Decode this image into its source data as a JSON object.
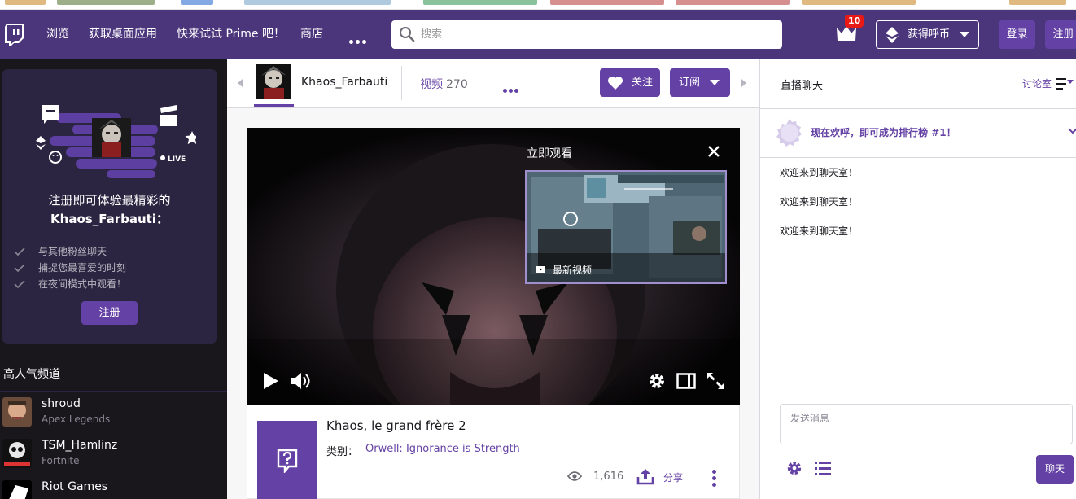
{
  "topnav": {
    "logo_icon": "twitch-glitch-icon",
    "links": [
      "浏览",
      "获取桌面应用",
      "快来试试 Prime 吧！",
      "商店"
    ],
    "search_placeholder": "搜索",
    "crown_icon": "prime-crown-icon",
    "notification_count": "10",
    "bits_label": "获得呼币",
    "login_label": "登录",
    "signup_label": "注册"
  },
  "sidebar": {
    "promo": {
      "title_line1": "注册即可体验最精彩的",
      "title_line2": "Khaos_Farbauti：",
      "live_label": "LIVE",
      "benefits": [
        "与其他粉丝聊天",
        "捕捉您最喜爱的时刻",
        "在夜间模式中观看！"
      ],
      "signup_label": "注册"
    },
    "section_title": "高人气频道",
    "channels": [
      {
        "name": "shroud",
        "game": "Apex Legends"
      },
      {
        "name": "TSM_Hamlinz",
        "game": "Fortnite"
      },
      {
        "name": "Riot Games",
        "game": ""
      }
    ]
  },
  "channel": {
    "name": "Khaos_Farbauti",
    "videos_label": "视频",
    "videos_count": "270",
    "follow_label": "关注",
    "subscribe_label": "订阅"
  },
  "player": {
    "popover_title": "立即观看",
    "latest_video_label": "最新视频",
    "controls": [
      "play-icon",
      "volume-icon",
      "settings-icon",
      "theatre-mode-icon",
      "fullscreen-icon"
    ]
  },
  "stream_info": {
    "title": "Khaos, le grand frère 2",
    "category_label": "类别：",
    "category": "Orwell: Ignorance is Strength",
    "viewers": "1,616",
    "share_label": "分享"
  },
  "chat": {
    "title": "直播聊天",
    "rooms_label": "讨论室",
    "leaderboard_text": "现在欢呼，即可成为排行榜 #1！",
    "messages": [
      "欢迎来到聊天室！",
      "欢迎来到聊天室！",
      "欢迎来到聊天室！"
    ],
    "input_placeholder": "发送消息",
    "send_label": "聊天"
  },
  "colors": {
    "brand_purple": "#6441a4",
    "nav_purple": "#4b367c",
    "sidebar_bg": "#19171c",
    "badge_red": "#e91916"
  }
}
